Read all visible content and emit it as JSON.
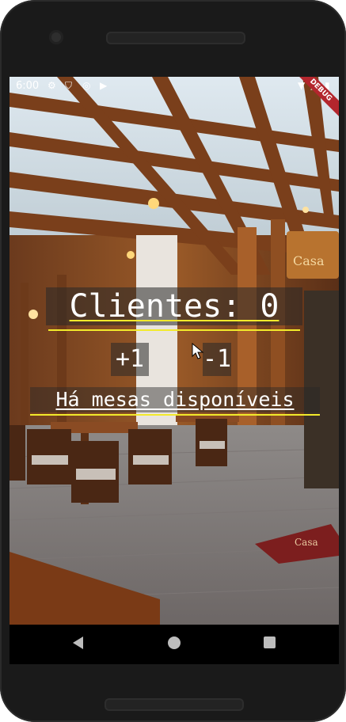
{
  "status_bar": {
    "time": "6:00",
    "icons": [
      "settings-icon",
      "shield-icon",
      "at-icon",
      "play-store-icon",
      "wifi-icon",
      "signal-icon",
      "battery-icon"
    ],
    "debug_banner": "DEBUG"
  },
  "app": {
    "counter_label": "Clientes: 0",
    "increment_label": "+1",
    "decrement_label": "-1",
    "status_message": "Há mesas disponíveis",
    "accent_color": "#f2ea2b",
    "background_image": "restaurant-interior"
  },
  "nav_bar": {
    "buttons": [
      "back",
      "home",
      "recents"
    ]
  }
}
